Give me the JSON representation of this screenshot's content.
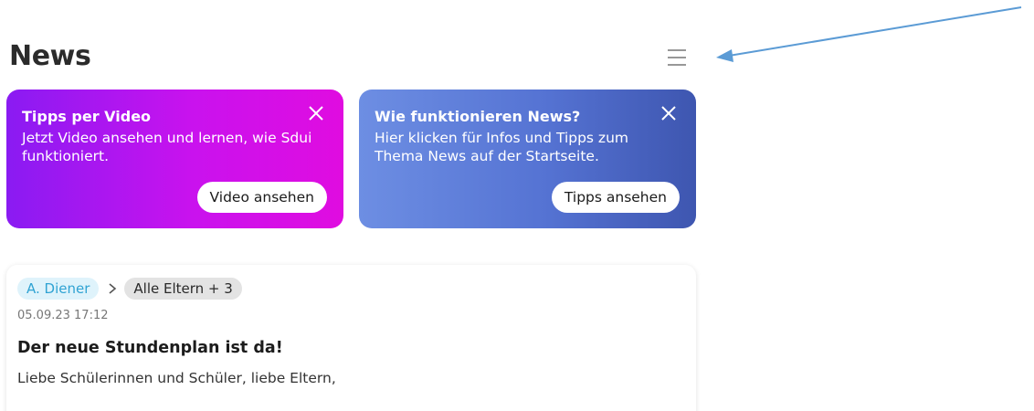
{
  "header": {
    "title": "News",
    "menu_icon": "hamburger-menu-icon"
  },
  "tips": [
    {
      "title": "Tipps per Video",
      "text": "Jetzt Video ansehen und lernen, wie Sdui funktioniert.",
      "button_label": "Video ansehen",
      "colors": [
        "#8a1bf2",
        "#e00ce0"
      ]
    },
    {
      "title": "Wie funktionieren News?",
      "text": "Hier klicken für Infos und Tipps zum Thema News auf der Startseite.",
      "button_label": "Tipps ansehen",
      "colors": [
        "#6d8ee3",
        "#3e56b0"
      ]
    }
  ],
  "post": {
    "author": "A. Diener",
    "recipients": "Alle Eltern + 3",
    "date": "05.09.23 17:12",
    "title": "Der neue Stundenplan ist da!",
    "body": "Liebe Schülerinnen und Schüler, liebe Eltern,"
  },
  "annotation": {
    "arrow_color": "#5b9bd5"
  }
}
